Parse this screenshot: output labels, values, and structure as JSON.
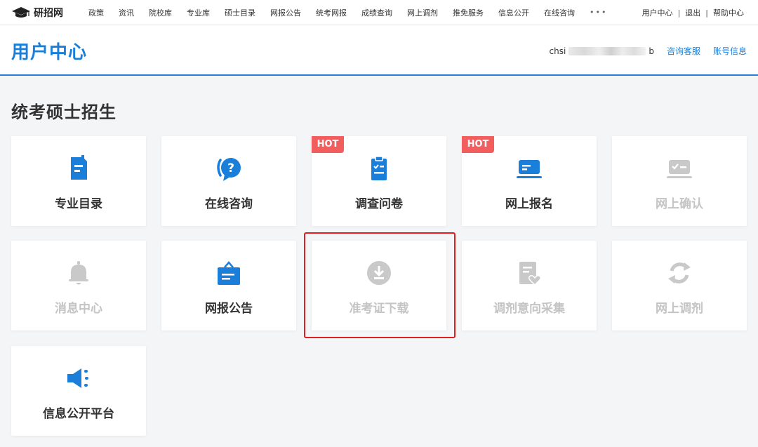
{
  "nav": {
    "brand": "研招网",
    "items": [
      "政策",
      "资讯",
      "院校库",
      "专业库",
      "硕士目录",
      "网报公告",
      "统考网报",
      "成绩查询",
      "网上调剂",
      "推免服务",
      "信息公开",
      "在线咨询"
    ],
    "more": "•••",
    "right": [
      "用户中心",
      "退出",
      "帮助中心"
    ],
    "separator": "|"
  },
  "header": {
    "title": "用户中心",
    "user_prefix": "chsi",
    "user_suffix": "b",
    "links": [
      "咨询客服",
      "账号信息"
    ]
  },
  "section": {
    "title": "统考硕士招生"
  },
  "colors": {
    "accent": "#1b7fd9",
    "disabled": "#c4c4c4",
    "hot": "#f25d5d",
    "highlight": "#e02020"
  },
  "cards": [
    {
      "label": "专业目录",
      "icon": "document-icon",
      "enabled": true,
      "badge": ""
    },
    {
      "label": "在线咨询",
      "icon": "question-chat-icon",
      "enabled": true,
      "badge": ""
    },
    {
      "label": "调查问卷",
      "icon": "clipboard-check-icon",
      "enabled": true,
      "badge": "HOT"
    },
    {
      "label": "网上报名",
      "icon": "laptop-icon",
      "enabled": true,
      "badge": "HOT"
    },
    {
      "label": "网上确认",
      "icon": "laptop-check-icon",
      "enabled": false,
      "badge": ""
    },
    {
      "label": "消息中心",
      "icon": "bell-icon",
      "enabled": false,
      "badge": ""
    },
    {
      "label": "网报公告",
      "icon": "notice-board-icon",
      "enabled": true,
      "badge": ""
    },
    {
      "label": "准考证下载",
      "icon": "download-circle-icon",
      "enabled": false,
      "badge": ""
    },
    {
      "label": "调剂意向采集",
      "icon": "document-heart-icon",
      "enabled": false,
      "badge": ""
    },
    {
      "label": "网上调剂",
      "icon": "refresh-icon",
      "enabled": false,
      "badge": ""
    },
    {
      "label": "信息公开平台",
      "icon": "megaphone-icon",
      "enabled": true,
      "badge": ""
    }
  ]
}
